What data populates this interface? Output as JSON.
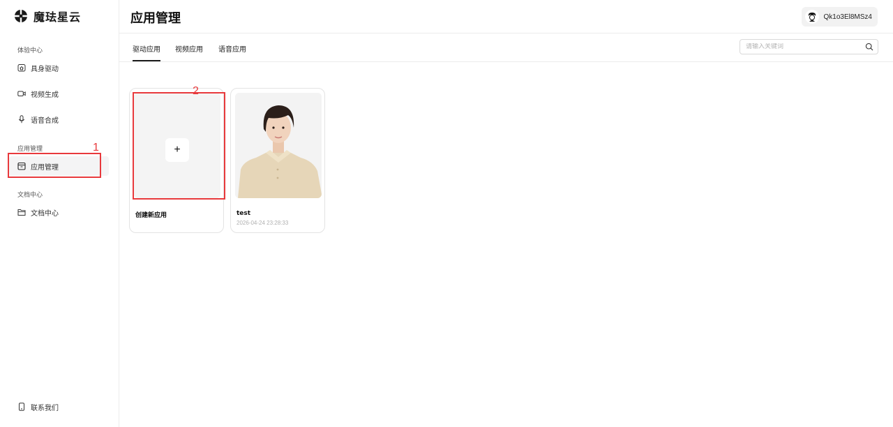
{
  "brand": {
    "name": "魔珐星云",
    "icon": "brand-logo-icon"
  },
  "sidebar": {
    "groups": [
      {
        "label": "体验中心",
        "items": [
          {
            "label": "具身驱动",
            "icon": "home-icon"
          },
          {
            "label": "视频生成",
            "icon": "video-icon"
          },
          {
            "label": "语音合成",
            "icon": "microphone-icon"
          }
        ]
      },
      {
        "label": "应用管理",
        "items": [
          {
            "label": "应用管理",
            "icon": "app-box-icon",
            "active": true
          }
        ]
      },
      {
        "label": "文档中心",
        "items": [
          {
            "label": "文档中心",
            "icon": "folder-icon"
          }
        ]
      }
    ],
    "footer": {
      "label": "联系我们",
      "icon": "phone-icon"
    }
  },
  "header": {
    "title": "应用管理",
    "user": {
      "name": "Qk1o3El8MSz4",
      "icon": "avatar-icon"
    }
  },
  "tabs": [
    {
      "label": "驱动应用",
      "active": true
    },
    {
      "label": "视频应用"
    },
    {
      "label": "语音应用"
    }
  ],
  "search": {
    "placeholder": "请输入关键词",
    "value": ""
  },
  "cards": [
    {
      "title": "创建新应用",
      "plus": "+"
    },
    {
      "title": "test",
      "date": "2026-04-24 23:28:33"
    }
  ],
  "annotations": {
    "first": "1",
    "second": "2"
  },
  "colors": {
    "annotation": "#e8393c",
    "active_bg": "#f4f4f5",
    "border": "#ececec"
  }
}
